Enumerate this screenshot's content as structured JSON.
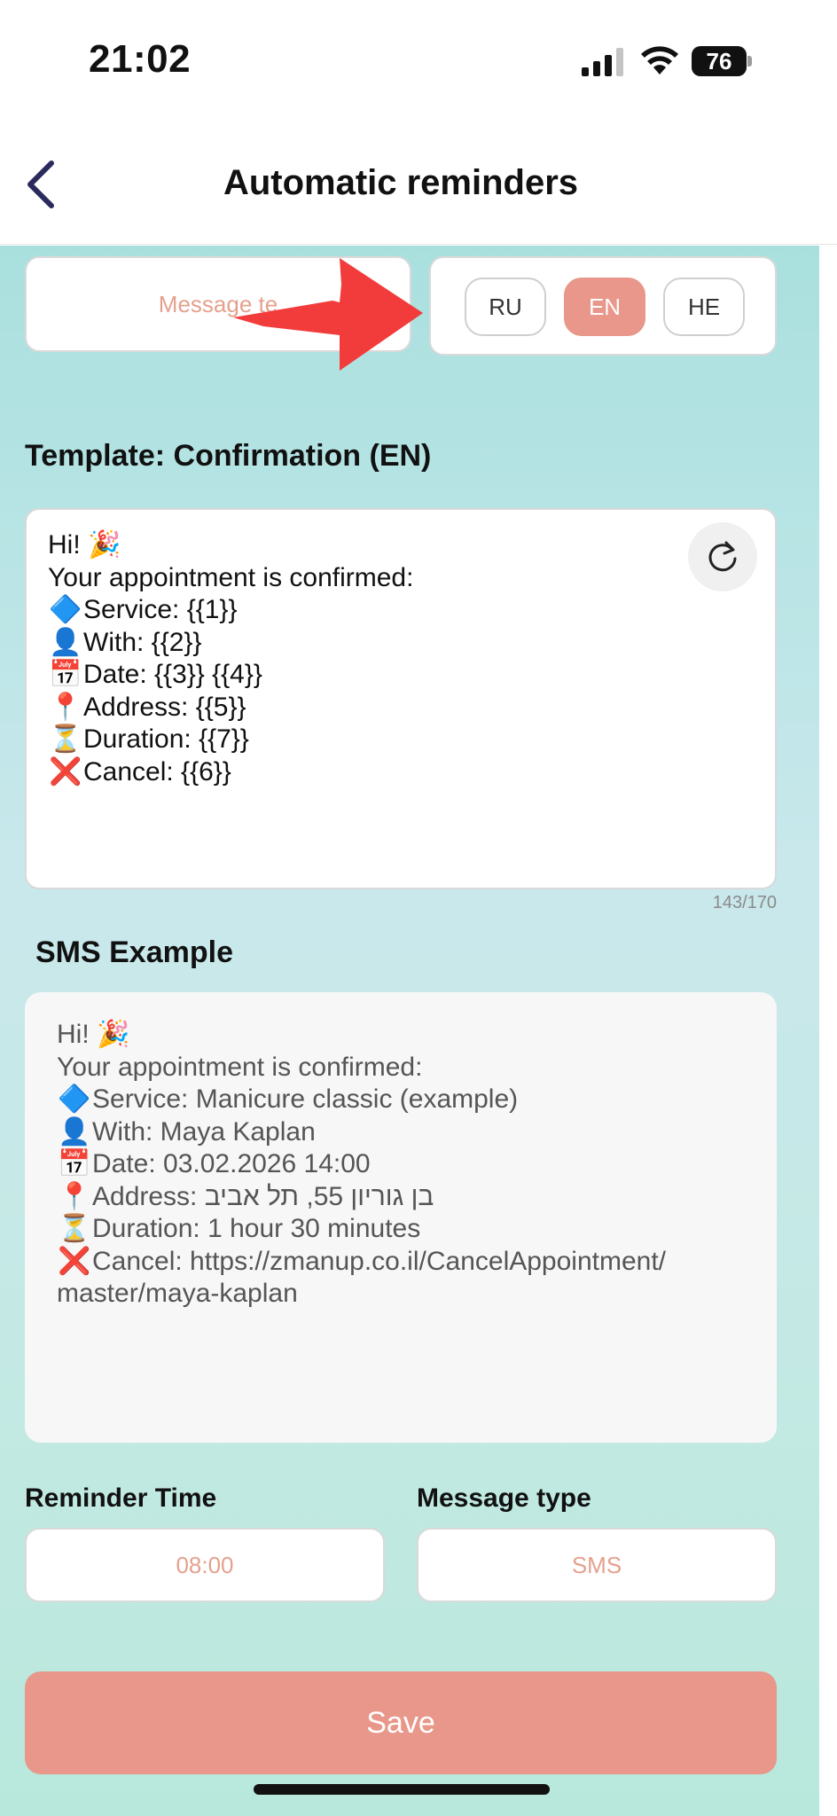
{
  "status_bar": {
    "time": "21:02",
    "battery": "76"
  },
  "nav": {
    "title": "Automatic reminders"
  },
  "message_template": {
    "placeholder": "Message te"
  },
  "language": {
    "options": [
      "RU",
      "EN",
      "HE"
    ],
    "selected": "EN"
  },
  "template": {
    "title": "Template: Confirmation (EN)",
    "lines": [
      {
        "emoji": "",
        "text": "Hi! 🎉"
      },
      {
        "emoji": "",
        "text": "Your appointment is confirmed:"
      },
      {
        "emoji": "🔷",
        "text": "Service: {{1}}"
      },
      {
        "emoji": "👤",
        "text": "With: {{2}}"
      },
      {
        "emoji": "📅",
        "text": "Date: {{3}} {{4}}"
      },
      {
        "emoji": "📍",
        "text": "Address: {{5}}"
      },
      {
        "emoji": "⏳",
        "text": "Duration: {{7}}"
      },
      {
        "emoji": "❌",
        "text": "Cancel: {{6}}"
      }
    ],
    "counter": "143/170"
  },
  "sms_example": {
    "title": "SMS Example",
    "lines": [
      {
        "emoji": "",
        "text": "Hi! 🎉"
      },
      {
        "emoji": "",
        "text": "Your appointment is confirmed:"
      },
      {
        "emoji": "🔷",
        "text": "Service: Manicure classic (example)"
      },
      {
        "emoji": "👤",
        "text": "With: Maya Kaplan"
      },
      {
        "emoji": "📅",
        "text": "Date: 03.02.2026 14:00"
      },
      {
        "emoji": "📍",
        "text": "Address: בן גוריון 55, תל אביב"
      },
      {
        "emoji": "⏳",
        "text": "Duration: 1 hour 30 minutes"
      },
      {
        "emoji": "❌",
        "text": "Cancel: https://zmanup.co.il/CancelAppointment/"
      },
      {
        "emoji": "",
        "text": "master/maya-kaplan"
      }
    ]
  },
  "reminder_time": {
    "label": "Reminder Time",
    "value": "08:00"
  },
  "message_type": {
    "label": "Message type",
    "value": "SMS"
  },
  "save": {
    "label": "Save"
  },
  "colors": {
    "accent": "#e8978a",
    "placeholder": "#e5a18e",
    "arrow": "#f23b3b"
  },
  "icons": {
    "back": "chevron-left-icon",
    "refresh": "refresh-icon"
  }
}
